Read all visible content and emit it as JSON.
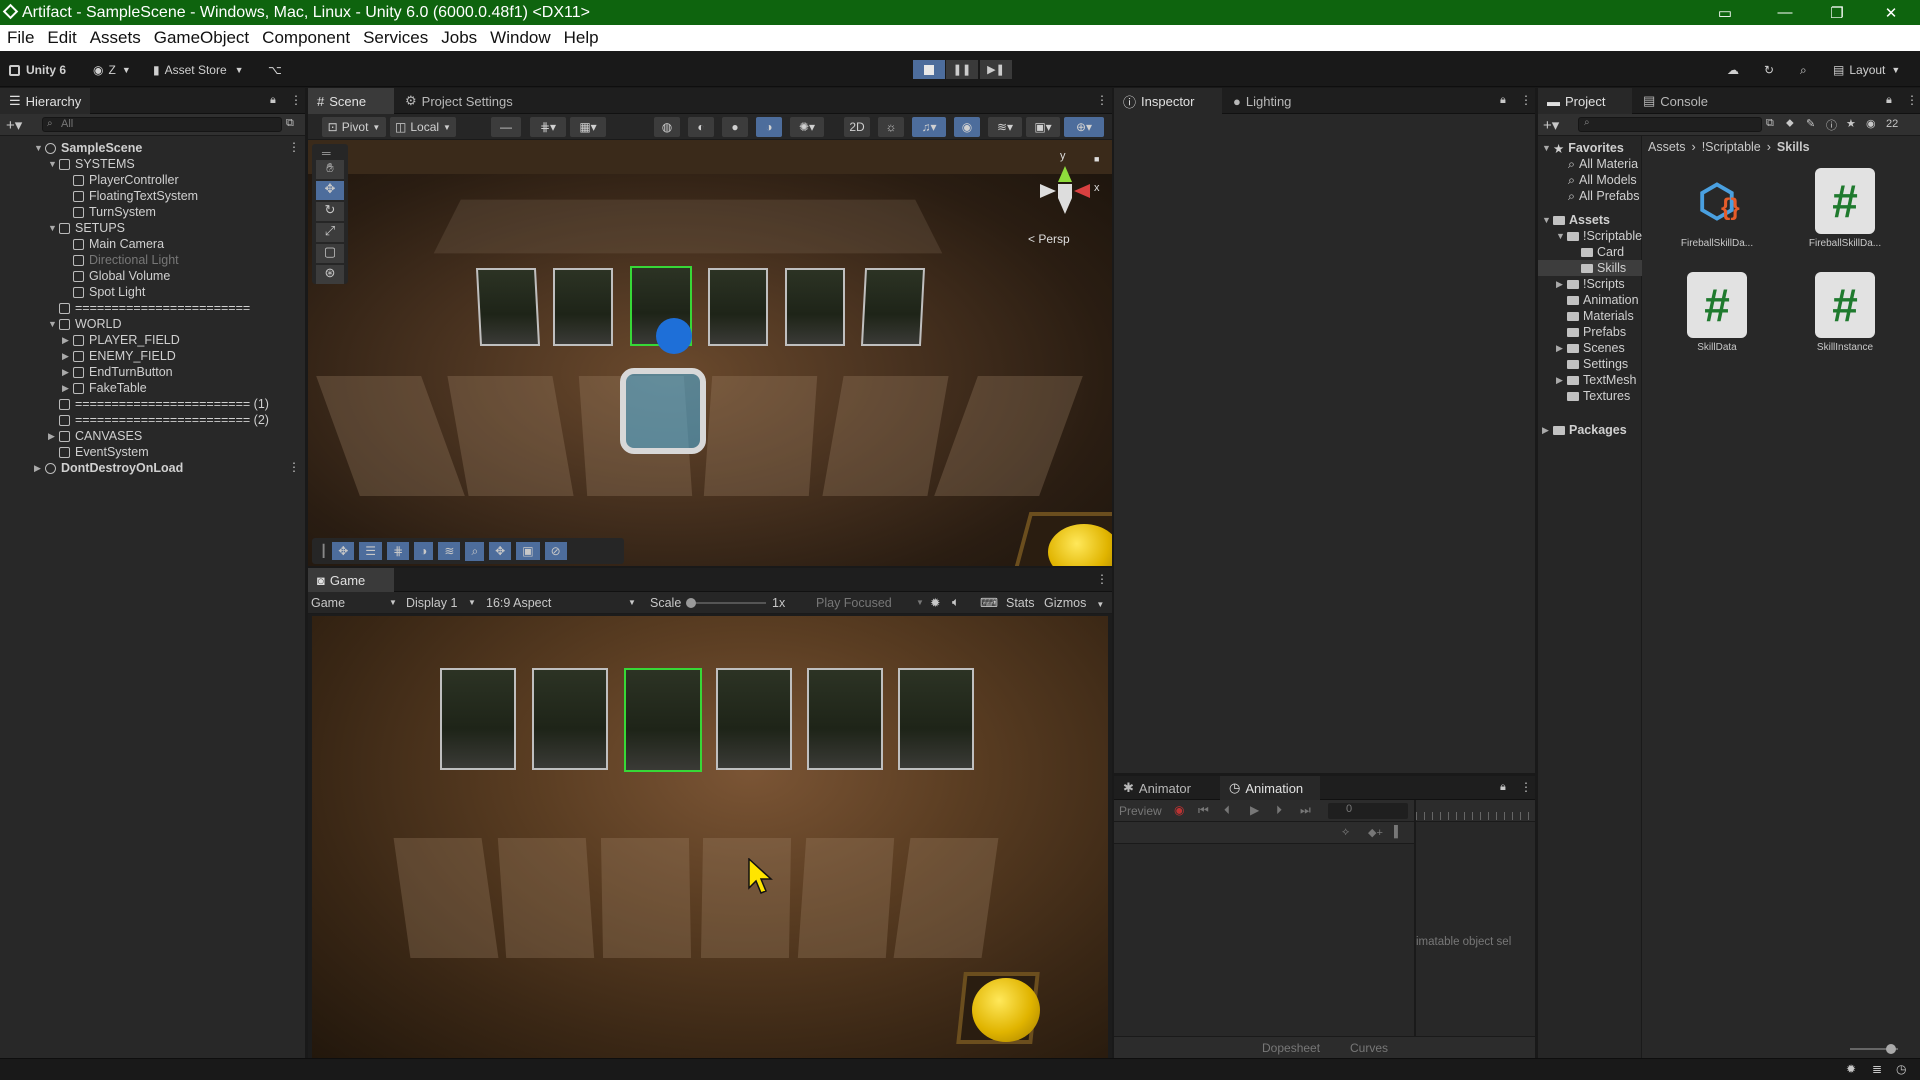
{
  "title_bar": {
    "title": "Artifact - SampleScene - Windows, Mac, Linux - Unity 6.0 (6000.0.48f1) <DX11>"
  },
  "menu": [
    "File",
    "Edit",
    "Assets",
    "GameObject",
    "Component",
    "Services",
    "Jobs",
    "Window",
    "Help"
  ],
  "toolbar": {
    "account": "Unity 6",
    "user": "Z",
    "asset_store": "Asset Store",
    "layout": "Layout"
  },
  "hierarchy": {
    "tab": "Hierarchy",
    "search_placeholder": "All",
    "items": [
      {
        "label": "SampleScene",
        "depth": 0,
        "arrow": "▼",
        "kind": "scene"
      },
      {
        "label": "SYSTEMS",
        "depth": 1,
        "arrow": "▼"
      },
      {
        "label": "PlayerController",
        "depth": 2,
        "arrow": ""
      },
      {
        "label": "FloatingTextSystem",
        "depth": 2,
        "arrow": ""
      },
      {
        "label": "TurnSystem",
        "depth": 2,
        "arrow": ""
      },
      {
        "label": "SETUPS",
        "depth": 1,
        "arrow": "▼"
      },
      {
        "label": "Main Camera",
        "depth": 2,
        "arrow": ""
      },
      {
        "label": "Directional Light",
        "depth": 2,
        "arrow": "",
        "disabled": true
      },
      {
        "label": "Global Volume",
        "depth": 2,
        "arrow": ""
      },
      {
        "label": "Spot Light",
        "depth": 2,
        "arrow": ""
      },
      {
        "label": "========================",
        "depth": 1,
        "arrow": ""
      },
      {
        "label": "WORLD",
        "depth": 1,
        "arrow": "▼"
      },
      {
        "label": "PLAYER_FIELD",
        "depth": 2,
        "arrow": "▶"
      },
      {
        "label": "ENEMY_FIELD",
        "depth": 2,
        "arrow": "▶"
      },
      {
        "label": "EndTurnButton",
        "depth": 2,
        "arrow": "▶"
      },
      {
        "label": "FakeTable",
        "depth": 2,
        "arrow": "▶"
      },
      {
        "label": "======================== (1)",
        "depth": 1,
        "arrow": ""
      },
      {
        "label": "======================== (2)",
        "depth": 1,
        "arrow": ""
      },
      {
        "label": "CANVASES",
        "depth": 1,
        "arrow": "▶"
      },
      {
        "label": "EventSystem",
        "depth": 1,
        "arrow": ""
      },
      {
        "label": "DontDestroyOnLoad",
        "depth": 0,
        "arrow": "▶",
        "kind": "scene"
      }
    ]
  },
  "scene": {
    "tabs": [
      "Scene",
      "Project Settings"
    ],
    "pivot": "Pivot",
    "local": "Local",
    "persp": "< Persp",
    "gizmo_y": "y",
    "gizmo_x": "x"
  },
  "game": {
    "tab": "Game",
    "mode": "Game",
    "display": "Display 1",
    "aspect": "16:9 Aspect",
    "scale_label": "Scale",
    "scale_value": "1x",
    "play_focused": "Play Focused",
    "stats": "Stats",
    "gizmos": "Gizmos"
  },
  "inspector": {
    "tabs": [
      "Inspector",
      "Lighting"
    ]
  },
  "animation": {
    "tabs": [
      "Animator",
      "Animation"
    ],
    "preview": "Preview",
    "frame": "0",
    "empty_msg": "imatable object sel",
    "dopesheet": "Dopesheet",
    "curves": "Curves"
  },
  "project": {
    "tabs": [
      "Project",
      "Console"
    ],
    "badge": "22",
    "favorites": {
      "label": "Favorites",
      "items": [
        "All Materia",
        "All Models",
        "All Prefabs"
      ]
    },
    "assets_label": "Assets",
    "tree": [
      {
        "label": "!Scriptable",
        "depth": 1,
        "arrow": "▼"
      },
      {
        "label": "Card",
        "depth": 2,
        "arrow": ""
      },
      {
        "label": "Skills",
        "depth": 2,
        "arrow": "",
        "selected": true
      },
      {
        "label": "!Scripts",
        "depth": 1,
        "arrow": "▶"
      },
      {
        "label": "Animation",
        "depth": 1,
        "arrow": ""
      },
      {
        "label": "Materials",
        "depth": 1,
        "arrow": ""
      },
      {
        "label": "Prefabs",
        "depth": 1,
        "arrow": ""
      },
      {
        "label": "Scenes",
        "depth": 1,
        "arrow": "▶"
      },
      {
        "label": "Settings",
        "depth": 1,
        "arrow": ""
      },
      {
        "label": "TextMesh",
        "depth": 1,
        "arrow": "▶"
      },
      {
        "label": "Textures",
        "depth": 1,
        "arrow": ""
      }
    ],
    "packages_label": "Packages",
    "breadcrumb": [
      "Assets",
      "!Scriptable",
      "Skills"
    ],
    "files": [
      {
        "name": "FireballSkillDa...",
        "icon": "scriptable-object-icon"
      },
      {
        "name": "FireballSkillDa...",
        "icon": "csharp-script-icon"
      },
      {
        "name": "SkillData",
        "icon": "csharp-script-icon"
      },
      {
        "name": "SkillInstance",
        "icon": "csharp-script-icon"
      }
    ]
  }
}
